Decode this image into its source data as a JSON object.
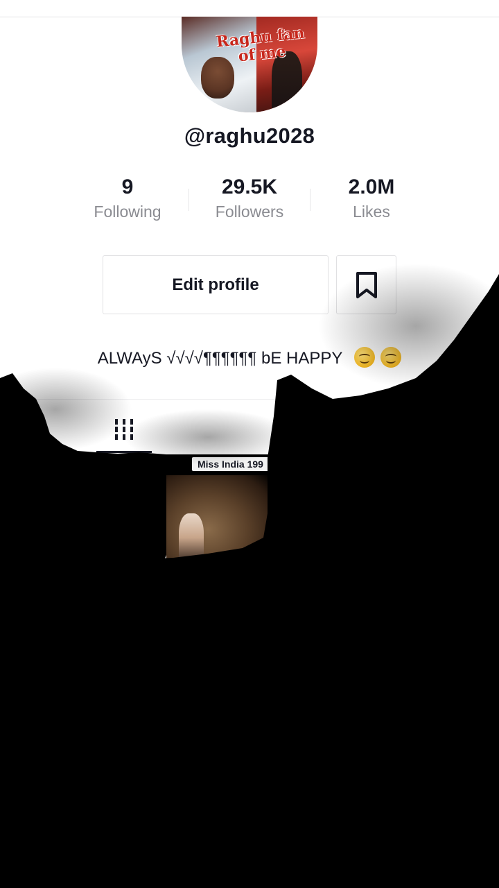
{
  "profile": {
    "username": "@raghu2028",
    "avatar_caption": "Raghu fan of me",
    "bio_text": "ALWAyS √√√√¶¶¶¶¶¶ bE HAPPY",
    "bio_emojis": [
      "smiling-face-emoji",
      "smiling-face-emoji"
    ]
  },
  "stats": {
    "following": {
      "count": "9",
      "label": "Following"
    },
    "followers": {
      "count": "29.5K",
      "label": "Followers"
    },
    "likes": {
      "count": "2.0M",
      "label": "Likes"
    }
  },
  "actions": {
    "edit_profile_label": "Edit profile",
    "bookmark_icon": "bookmark-icon"
  },
  "tabs": {
    "active": "grid-icon"
  },
  "videos": [
    {
      "label": ""
    },
    {
      "label": "Miss India 199"
    }
  ],
  "colors": {
    "text": "#161823",
    "muted": "#8a8b91",
    "border": "#e0e0e2"
  }
}
